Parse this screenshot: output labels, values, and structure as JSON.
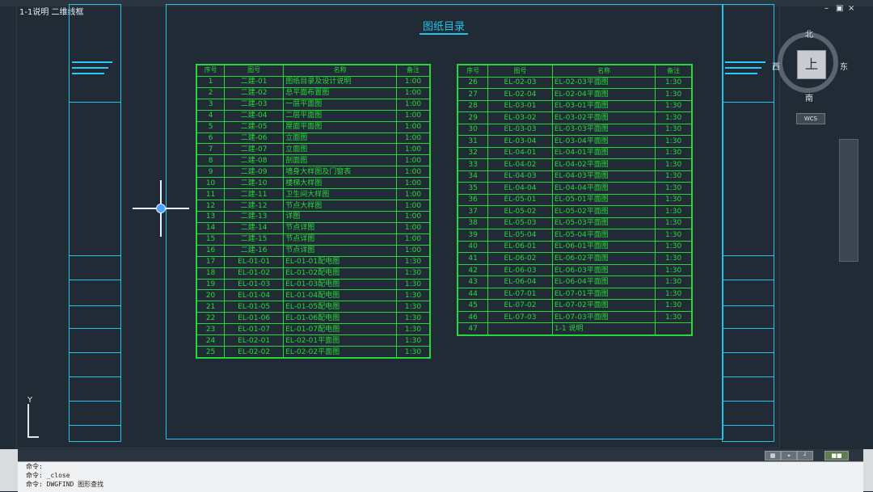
{
  "window": {
    "title": "1-1说明 二维线框",
    "minimize_icon": "minimize-icon",
    "restore_icon": "restore-icon",
    "close_icon": "close-icon"
  },
  "drawing": {
    "sheet_title": "图纸目录",
    "left_table": {
      "headers": [
        "序号",
        "图号",
        "名称",
        "备注"
      ],
      "rows": [
        [
          "1",
          "二建-01",
          "图纸目录及设计说明",
          "1:00"
        ],
        [
          "2",
          "二建-02",
          "总平面布置图",
          "1:00"
        ],
        [
          "3",
          "二建-03",
          "一层平面图",
          "1:00"
        ],
        [
          "4",
          "二建-04",
          "二层平面图",
          "1:00"
        ],
        [
          "5",
          "二建-05",
          "屋面平面图",
          "1:00"
        ],
        [
          "6",
          "二建-06",
          "立面图",
          "1:00"
        ],
        [
          "7",
          "二建-07",
          "立面图",
          "1:00"
        ],
        [
          "8",
          "二建-08",
          "剖面图",
          "1:00"
        ],
        [
          "9",
          "二建-09",
          "墙身大样图及门窗表",
          "1:00"
        ],
        [
          "10",
          "二建-10",
          "楼梯大样图",
          "1:00"
        ],
        [
          "11",
          "二建-11",
          "卫生间大样图",
          "1:00"
        ],
        [
          "12",
          "二建-12",
          "节点大样图",
          "1:00"
        ],
        [
          "13",
          "二建-13",
          "详图",
          "1:00"
        ],
        [
          "14",
          "二建-14",
          "节点详图",
          "1:00"
        ],
        [
          "15",
          "二建-15",
          "节点详图",
          "1:00"
        ],
        [
          "16",
          "二建-16",
          "节点详图",
          "1:00"
        ],
        [
          "17",
          "EL-01-01",
          "EL-01-01配电图",
          "1:30"
        ],
        [
          "18",
          "EL-01-02",
          "EL-01-02配电图",
          "1:30"
        ],
        [
          "19",
          "EL-01-03",
          "EL-01-03配电图",
          "1:30"
        ],
        [
          "20",
          "EL-01-04",
          "EL-01-04配电图",
          "1:30"
        ],
        [
          "21",
          "EL-01-05",
          "EL-01-05配电图",
          "1:30"
        ],
        [
          "22",
          "EL-01-06",
          "EL-01-06配电图",
          "1:30"
        ],
        [
          "23",
          "EL-01-07",
          "EL-01-07配电图",
          "1:30"
        ],
        [
          "24",
          "EL-02-01",
          "EL-02-01平面图",
          "1:30"
        ],
        [
          "25",
          "EL-02-02",
          "EL-02-02平面图",
          "1:30"
        ]
      ]
    },
    "right_table": {
      "headers": [
        "序号",
        "图号",
        "名称",
        "备注"
      ],
      "rows": [
        [
          "26",
          "EL-02-03",
          "EL-02-03平面图",
          "1:30"
        ],
        [
          "27",
          "EL-02-04",
          "EL-02-04平面图",
          "1:30"
        ],
        [
          "28",
          "EL-03-01",
          "EL-03-01平面图",
          "1:30"
        ],
        [
          "29",
          "EL-03-02",
          "EL-03-02平面图",
          "1:30"
        ],
        [
          "30",
          "EL-03-03",
          "EL-03-03平面图",
          "1:30"
        ],
        [
          "31",
          "EL-03-04",
          "EL-03-04平面图",
          "1:30"
        ],
        [
          "32",
          "EL-04-01",
          "EL-04-01平面图",
          "1:30"
        ],
        [
          "33",
          "EL-04-02",
          "EL-04-02平面图",
          "1:30"
        ],
        [
          "34",
          "EL-04-03",
          "EL-04-03平面图",
          "1:30"
        ],
        [
          "35",
          "EL-04-04",
          "EL-04-04平面图",
          "1:30"
        ],
        [
          "36",
          "EL-05-01",
          "EL-05-01平面图",
          "1:30"
        ],
        [
          "37",
          "EL-05-02",
          "EL-05-02平面图",
          "1:30"
        ],
        [
          "38",
          "EL-05-03",
          "EL-05-03平面图",
          "1:30"
        ],
        [
          "39",
          "EL-05-04",
          "EL-05-04平面图",
          "1:30"
        ],
        [
          "40",
          "EL-06-01",
          "EL-06-01平面图",
          "1:30"
        ],
        [
          "41",
          "EL-06-02",
          "EL-06-02平面图",
          "1:30"
        ],
        [
          "42",
          "EL-06-03",
          "EL-06-03平面图",
          "1:30"
        ],
        [
          "43",
          "EL-06-04",
          "EL-06-04平面图",
          "1:30"
        ],
        [
          "44",
          "EL-07-01",
          "EL-07-01平面图",
          "1:30"
        ],
        [
          "45",
          "EL-07-02",
          "EL-07-02平面图",
          "1:30"
        ],
        [
          "46",
          "EL-07-03",
          "EL-07-03平面图",
          "1:30"
        ],
        [
          "47",
          "",
          "1-1 说明",
          ""
        ]
      ]
    }
  },
  "navigation": {
    "compass": {
      "north": "北",
      "south": "南",
      "east": "东",
      "west": "西"
    },
    "cube_face": "上",
    "wcs_label": "WCS"
  },
  "command": {
    "lines": [
      "命令:",
      "命令: _close",
      "命令: DWGFIND 图形查找"
    ]
  },
  "status": {
    "icons": [
      "grid-icon",
      "snap-icon",
      "ortho-icon",
      "model-icon"
    ]
  }
}
